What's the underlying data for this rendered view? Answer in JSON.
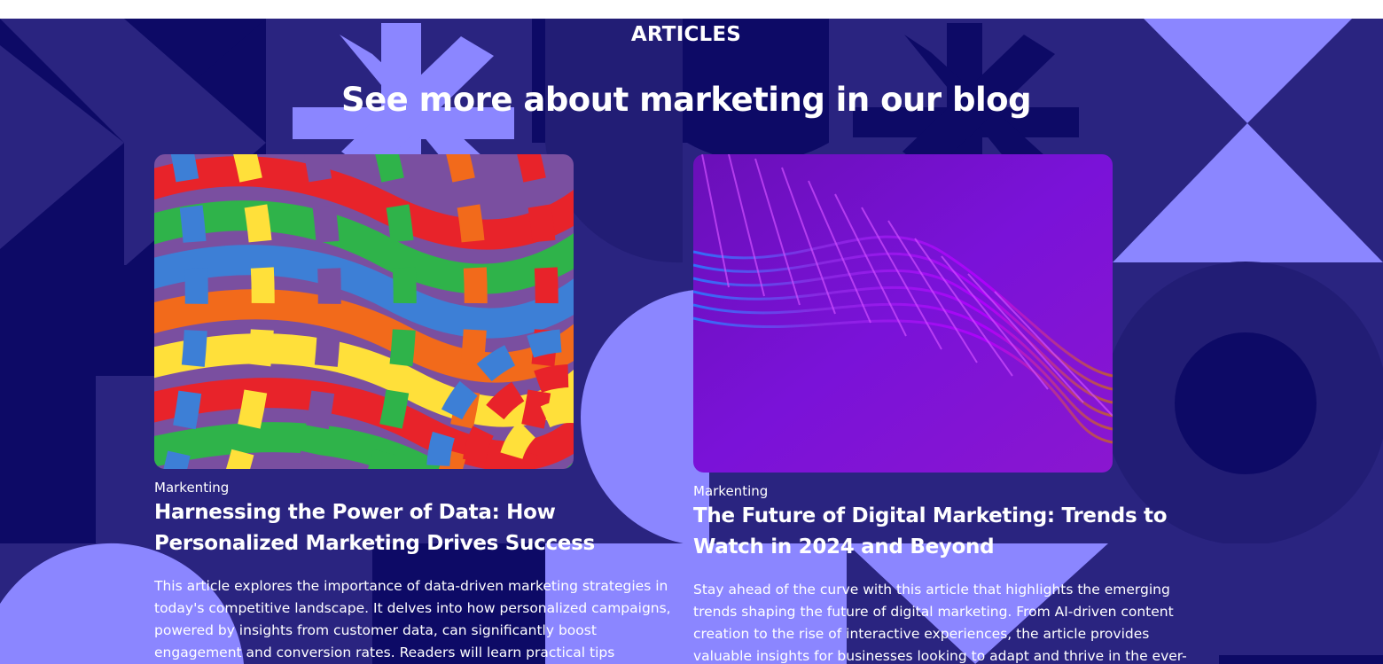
{
  "section": {
    "eyebrow": "ARTICLES",
    "heading": "See more about marketing in our blog"
  },
  "articles": [
    {
      "category": "Markenting",
      "title": "Harnessing the Power of Data: How Personalized Marketing Drives Success",
      "excerpt": "This article explores the importance of data-driven marketing strategies in today's competitive landscape. It delves into how personalized campaigns, powered by insights from customer data, can significantly boost engagement and conversion rates. Readers will learn practical tips",
      "image": "colorful-abstract-tile-pattern"
    },
    {
      "category": "Markenting",
      "title": "The Future of Digital Marketing: Trends to Watch in 2024 and Beyond",
      "excerpt": "Stay ahead of the curve with this article that highlights the emerging trends shaping the future of digital marketing. From AI-driven content creation to the rise of interactive experiences, the article provides valuable insights for businesses looking to adapt and thrive in the ever-",
      "image": "purple-abstract-wave"
    }
  ],
  "colors": {
    "background": "#2a2480",
    "navy": "#0d0a66",
    "lavender": "#8b86ff",
    "text": "#ffffff"
  }
}
